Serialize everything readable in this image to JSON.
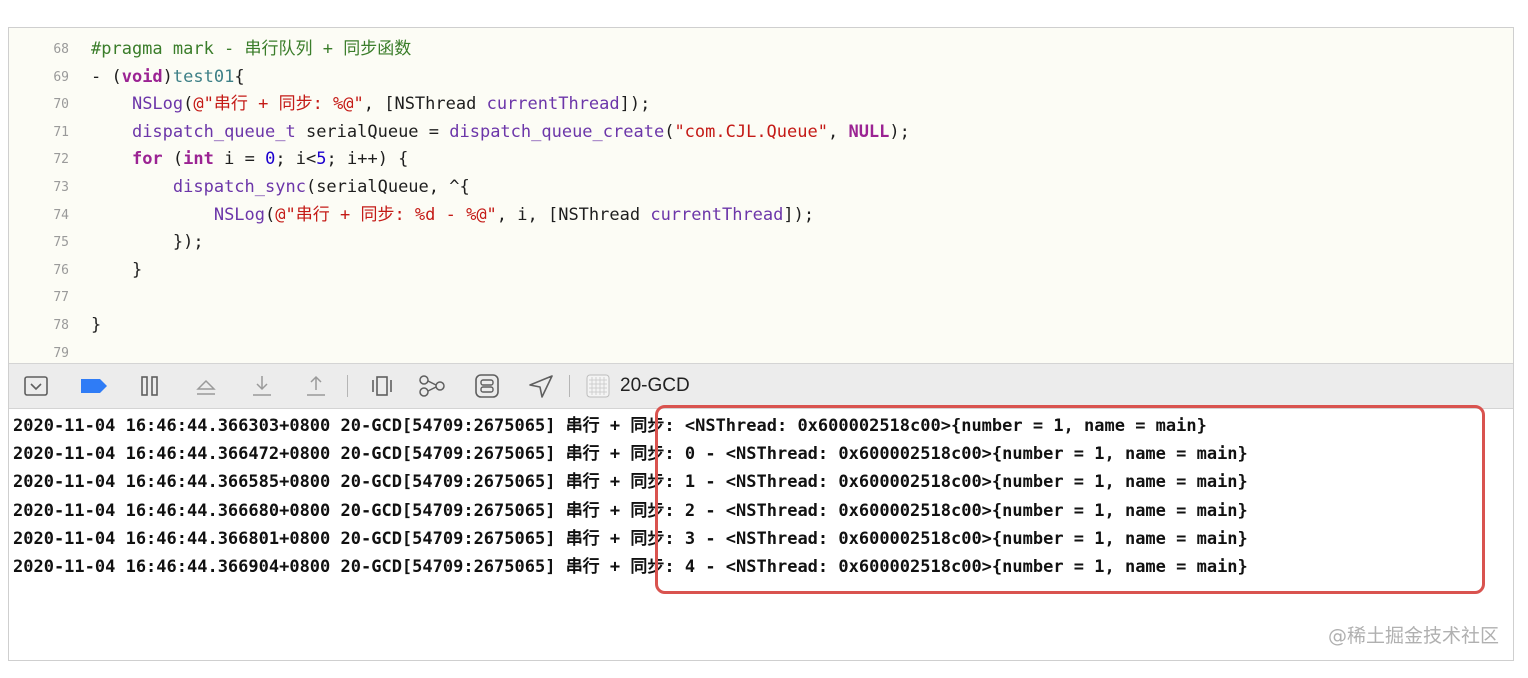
{
  "editor": {
    "lines": [
      {
        "n": "68",
        "tokens": [
          {
            "c": "c-mark",
            "t": "#pragma mark - 串行队列 + 同步函数"
          }
        ]
      },
      {
        "n": "69",
        "tokens": [
          {
            "c": "c-pl",
            "t": "- ("
          },
          {
            "c": "c-kw",
            "t": "void"
          },
          {
            "c": "c-pl",
            "t": ")"
          },
          {
            "c": "c-fn",
            "t": "test01"
          },
          {
            "c": "c-pl",
            "t": "{"
          }
        ]
      },
      {
        "n": "70",
        "tokens": [
          {
            "c": "c-pl",
            "t": "    "
          },
          {
            "c": "c-func",
            "t": "NSLog"
          },
          {
            "c": "c-pl",
            "t": "("
          },
          {
            "c": "c-str",
            "t": "@\"串行 + 同步: %@\""
          },
          {
            "c": "c-pl",
            "t": ", [NSThread "
          },
          {
            "c": "c-func",
            "t": "currentThread"
          },
          {
            "c": "c-pl",
            "t": "]);"
          }
        ]
      },
      {
        "n": "71",
        "tokens": [
          {
            "c": "c-pl",
            "t": "    "
          },
          {
            "c": "c-func",
            "t": "dispatch_queue_t"
          },
          {
            "c": "c-pl",
            "t": " serialQueue = "
          },
          {
            "c": "c-func",
            "t": "dispatch_queue_create"
          },
          {
            "c": "c-pl",
            "t": "("
          },
          {
            "c": "c-str",
            "t": "\"com.CJL.Queue\""
          },
          {
            "c": "c-pl",
            "t": ", "
          },
          {
            "c": "c-kw",
            "t": "NULL"
          },
          {
            "c": "c-pl",
            "t": ");"
          }
        ]
      },
      {
        "n": "72",
        "tokens": [
          {
            "c": "c-pl",
            "t": "    "
          },
          {
            "c": "c-kw",
            "t": "for"
          },
          {
            "c": "c-pl",
            "t": " ("
          },
          {
            "c": "c-kw",
            "t": "int"
          },
          {
            "c": "c-pl",
            "t": " i = "
          },
          {
            "c": "c-num",
            "t": "0"
          },
          {
            "c": "c-pl",
            "t": "; i<"
          },
          {
            "c": "c-num",
            "t": "5"
          },
          {
            "c": "c-pl",
            "t": "; i++) {"
          }
        ]
      },
      {
        "n": "73",
        "tokens": [
          {
            "c": "c-pl",
            "t": "        "
          },
          {
            "c": "c-func",
            "t": "dispatch_sync"
          },
          {
            "c": "c-pl",
            "t": "(serialQueue, ^{"
          }
        ]
      },
      {
        "n": "74",
        "tokens": [
          {
            "c": "c-pl",
            "t": "            "
          },
          {
            "c": "c-func",
            "t": "NSLog"
          },
          {
            "c": "c-pl",
            "t": "("
          },
          {
            "c": "c-str",
            "t": "@\"串行 + 同步: %d - %@\""
          },
          {
            "c": "c-pl",
            "t": ", i, [NSThread "
          },
          {
            "c": "c-func",
            "t": "currentThread"
          },
          {
            "c": "c-pl",
            "t": "]);"
          }
        ]
      },
      {
        "n": "75",
        "tokens": [
          {
            "c": "c-pl",
            "t": "        });"
          }
        ]
      },
      {
        "n": "76",
        "tokens": [
          {
            "c": "c-pl",
            "t": "    }"
          }
        ]
      },
      {
        "n": "77",
        "tokens": []
      },
      {
        "n": "78",
        "tokens": [
          {
            "c": "c-pl",
            "t": "}"
          }
        ]
      },
      {
        "n": "79",
        "tokens": []
      }
    ]
  },
  "toolbar": {
    "target_label": "20-GCD"
  },
  "console": {
    "lines": [
      {
        "prefix": "2020-11-04 16:46:44.366303+0800 20-GCD[54709:2675065] ",
        "msg": "串行 + 同步: <NSThread: 0x600002518c00>{number = 1, name = main}"
      },
      {
        "prefix": "2020-11-04 16:46:44.366472+0800 20-GCD[54709:2675065] ",
        "msg": "串行 + 同步: 0 - <NSThread: 0x600002518c00>{number = 1, name = main}"
      },
      {
        "prefix": "2020-11-04 16:46:44.366585+0800 20-GCD[54709:2675065] ",
        "msg": "串行 + 同步: 1 - <NSThread: 0x600002518c00>{number = 1, name = main}"
      },
      {
        "prefix": "2020-11-04 16:46:44.366680+0800 20-GCD[54709:2675065] ",
        "msg": "串行 + 同步: 2 - <NSThread: 0x600002518c00>{number = 1, name = main}"
      },
      {
        "prefix": "2020-11-04 16:46:44.366801+0800 20-GCD[54709:2675065] ",
        "msg": "串行 + 同步: 3 - <NSThread: 0x600002518c00>{number = 1, name = main}"
      },
      {
        "prefix": "2020-11-04 16:46:44.366904+0800 20-GCD[54709:2675065] ",
        "msg": "串行 + 同步: 4 - <NSThread: 0x600002518c00>{number = 1, name = main}"
      }
    ]
  },
  "watermark": "@稀土掘金技术社区"
}
